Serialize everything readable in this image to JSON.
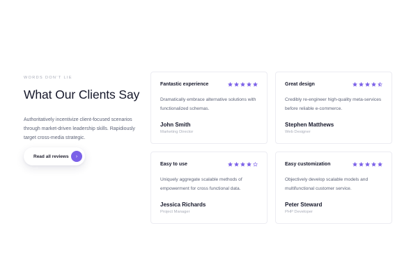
{
  "intro": {
    "eyebrow": "WORDS DON'T LIE",
    "title": "What Our Clients Say",
    "description": "Authoritatively incentivize client-focused scenarios through market-driven leadership skills. Rapidiously target cross-media strategic.",
    "button_label": "Read all reviews",
    "button_icon": "chevron-right-icon"
  },
  "colors": {
    "accent": "#7b61e8",
    "star_filled": "#7b61e8",
    "heading": "#15172a",
    "muted": "#a8acb8"
  },
  "reviews": [
    {
      "title": "Fantastic experience",
      "rating": 5,
      "body": "Dramatically embrace alternative solutions with functionalized schemas.",
      "name": "John Smith",
      "role": "Marketing Director"
    },
    {
      "title": "Great design",
      "rating": 4.5,
      "body": "Credibly re-engineer high-quality meta-services before reliable e-commerce.",
      "name": "Stephen Matthews",
      "role": "Web Designer"
    },
    {
      "title": "Easy to use",
      "rating": 4,
      "body": "Uniquely aggregate scalable methods of empowerment for cross functional data.",
      "name": "Jessica Richards",
      "role": "Project Manager"
    },
    {
      "title": "Easy customization",
      "rating": 5,
      "body": "Objectively develop scalable models and multifunctional customer service.",
      "name": "Peter Steward",
      "role": "PHP Developer"
    }
  ]
}
